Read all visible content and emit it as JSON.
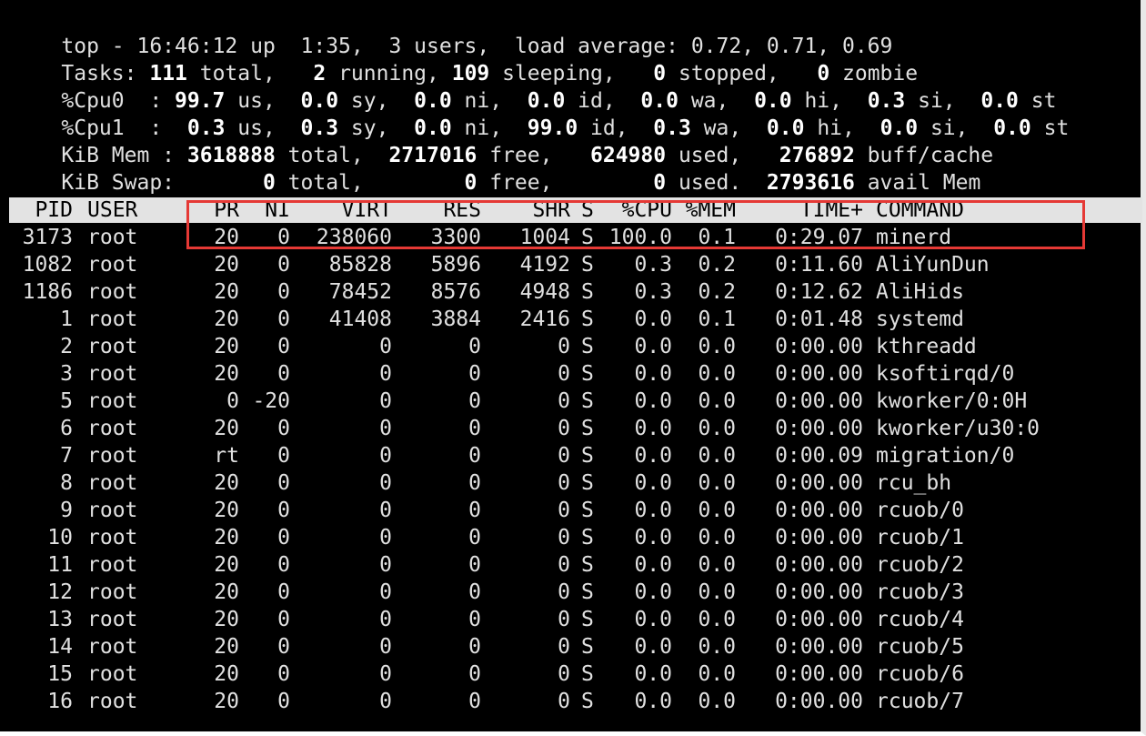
{
  "summary": {
    "top_line": {
      "prefix": "top - ",
      "time": "16:46:12",
      "up_label": " up  ",
      "uptime": "1:35,",
      "users": "  3 users,  ",
      "load_label": "load average: ",
      "load": "0.72, 0.71, 0.69"
    },
    "tasks": {
      "label": "Tasks:",
      "total": "111",
      "total_label": " total,   ",
      "running": "2",
      "running_label": " running, ",
      "sleeping": "109",
      "sleeping_label": " sleeping,   ",
      "stopped": "0",
      "stopped_label": " stopped,   ",
      "zombie": "0",
      "zombie_label": " zombie"
    },
    "cpu0": {
      "label": "%Cpu0  : ",
      "us": "99.7",
      "sy": "0.0",
      "ni": "0.0",
      "id": "0.0",
      "wa": "0.0",
      "hi": "0.0",
      "si": "0.3",
      "st": "0.0"
    },
    "cpu1": {
      "label": "%Cpu1  :  ",
      "us": "0.3",
      "sy": "0.3",
      "ni": "0.0",
      "id": "99.0",
      "wa": "0.3",
      "hi": "0.0",
      "si": "0.0",
      "st": "0.0"
    },
    "cpu_labels": {
      "us": " us,  ",
      "sy": " sy,  ",
      "ni": " ni,  ",
      "id": " id,  ",
      "wa": " wa,  ",
      "hi": " hi,  ",
      "si": " si,  ",
      "st": " st"
    },
    "mem": {
      "label": "KiB Mem : ",
      "total": "3618888",
      "total_label": " total,  ",
      "free": "2717016",
      "free_label": " free,   ",
      "used": "624980",
      "used_label": " used,   ",
      "buff": "276892",
      "buff_label": " buff/cache"
    },
    "swap": {
      "label": "KiB Swap:       ",
      "total": "0",
      "total_label": " total,        ",
      "free": "0",
      "free_label": " free,        ",
      "used": "0",
      "used_label": " used.  ",
      "avail": "2793616",
      "avail_label": " avail Mem"
    }
  },
  "columns": [
    "PID",
    "USER",
    "PR",
    "NI",
    "VIRT",
    "RES",
    "SHR",
    "S",
    "%CPU",
    "%MEM",
    "TIME+",
    "COMMAND"
  ],
  "processes": [
    [
      "3173",
      "root",
      "20",
      "0",
      "238060",
      "3300",
      "1004",
      "S",
      "100.0",
      "0.1",
      "0:29.07",
      "minerd"
    ],
    [
      "1082",
      "root",
      "20",
      "0",
      "85828",
      "5896",
      "4192",
      "S",
      "0.3",
      "0.2",
      "0:11.60",
      "AliYunDun"
    ],
    [
      "1186",
      "root",
      "20",
      "0",
      "78452",
      "8576",
      "4948",
      "S",
      "0.3",
      "0.2",
      "0:12.62",
      "AliHids"
    ],
    [
      "1",
      "root",
      "20",
      "0",
      "41408",
      "3884",
      "2416",
      "S",
      "0.0",
      "0.1",
      "0:01.48",
      "systemd"
    ],
    [
      "2",
      "root",
      "20",
      "0",
      "0",
      "0",
      "0",
      "S",
      "0.0",
      "0.0",
      "0:00.00",
      "kthreadd"
    ],
    [
      "3",
      "root",
      "20",
      "0",
      "0",
      "0",
      "0",
      "S",
      "0.0",
      "0.0",
      "0:00.00",
      "ksoftirqd/0"
    ],
    [
      "5",
      "root",
      "0",
      "-20",
      "0",
      "0",
      "0",
      "S",
      "0.0",
      "0.0",
      "0:00.00",
      "kworker/0:0H"
    ],
    [
      "6",
      "root",
      "20",
      "0",
      "0",
      "0",
      "0",
      "S",
      "0.0",
      "0.0",
      "0:00.00",
      "kworker/u30:0"
    ],
    [
      "7",
      "root",
      "rt",
      "0",
      "0",
      "0",
      "0",
      "S",
      "0.0",
      "0.0",
      "0:00.09",
      "migration/0"
    ],
    [
      "8",
      "root",
      "20",
      "0",
      "0",
      "0",
      "0",
      "S",
      "0.0",
      "0.0",
      "0:00.00",
      "rcu_bh"
    ],
    [
      "9",
      "root",
      "20",
      "0",
      "0",
      "0",
      "0",
      "S",
      "0.0",
      "0.0",
      "0:00.00",
      "rcuob/0"
    ],
    [
      "10",
      "root",
      "20",
      "0",
      "0",
      "0",
      "0",
      "S",
      "0.0",
      "0.0",
      "0:00.00",
      "rcuob/1"
    ],
    [
      "11",
      "root",
      "20",
      "0",
      "0",
      "0",
      "0",
      "S",
      "0.0",
      "0.0",
      "0:00.00",
      "rcuob/2"
    ],
    [
      "12",
      "root",
      "20",
      "0",
      "0",
      "0",
      "0",
      "S",
      "0.0",
      "0.0",
      "0:00.00",
      "rcuob/3"
    ],
    [
      "13",
      "root",
      "20",
      "0",
      "0",
      "0",
      "0",
      "S",
      "0.0",
      "0.0",
      "0:00.00",
      "rcuob/4"
    ],
    [
      "14",
      "root",
      "20",
      "0",
      "0",
      "0",
      "0",
      "S",
      "0.0",
      "0.0",
      "0:00.00",
      "rcuob/5"
    ],
    [
      "15",
      "root",
      "20",
      "0",
      "0",
      "0",
      "0",
      "S",
      "0.0",
      "0.0",
      "0:00.00",
      "rcuob/6"
    ],
    [
      "16",
      "root",
      "20",
      "0",
      "0",
      "0",
      "0",
      "S",
      "0.0",
      "0.0",
      "0:00.00",
      "rcuob/7"
    ]
  ],
  "colors": {
    "background": "#000000",
    "text": "#e0e0e0",
    "header_bg": "#e3e3e3",
    "highlight_border": "#e53935"
  }
}
